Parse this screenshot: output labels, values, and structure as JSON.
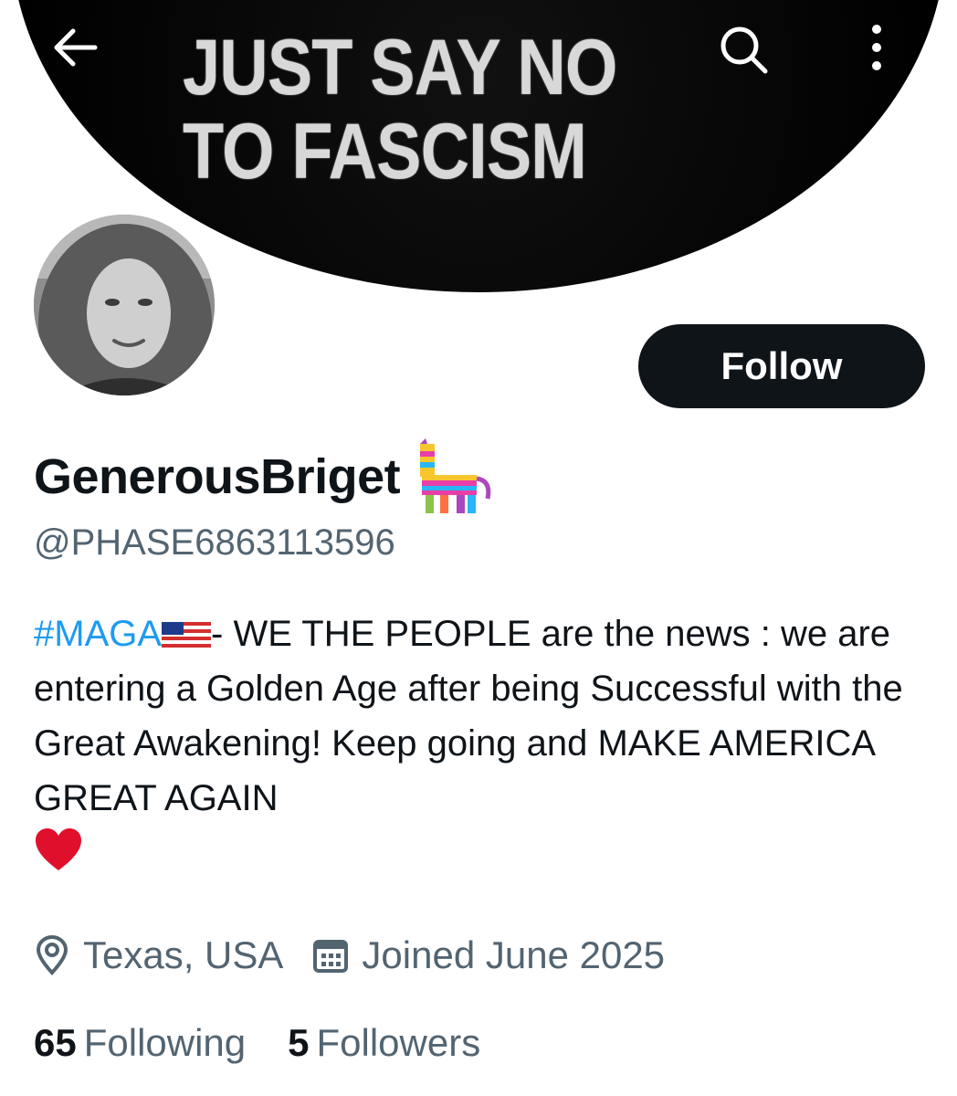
{
  "banner": {
    "text": "JUST SAY NO\nTO FASCISM"
  },
  "topbar": {
    "back_icon": "arrow-left-icon",
    "search_icon": "search-icon",
    "more_icon": "more-vertical-icon"
  },
  "profile": {
    "display_name": "GenerousBriget",
    "name_emoji": "pinata-icon",
    "handle": "@PHASE6863113596",
    "follow_label": "Follow"
  },
  "bio": {
    "hashtag": "#MAGA",
    "flag_icon": "us-flag-icon",
    "text": "- WE THE PEOPLE are the news : we are entering a Golden Age after being Successful with the Great Awakening! Keep going and MAKE AMERICA GREAT AGAIN",
    "heart_icon": "red-heart-icon"
  },
  "meta": {
    "location": "Texas, USA",
    "joined": "Joined June 2025"
  },
  "stats": {
    "following_count": "65",
    "following_label": "Following",
    "followers_count": "5",
    "followers_label": "Followers"
  },
  "colors": {
    "accent": "#1d9bf0",
    "text": "#0f1419",
    "secondary": "#536471",
    "follow_bg": "#0f1419"
  }
}
